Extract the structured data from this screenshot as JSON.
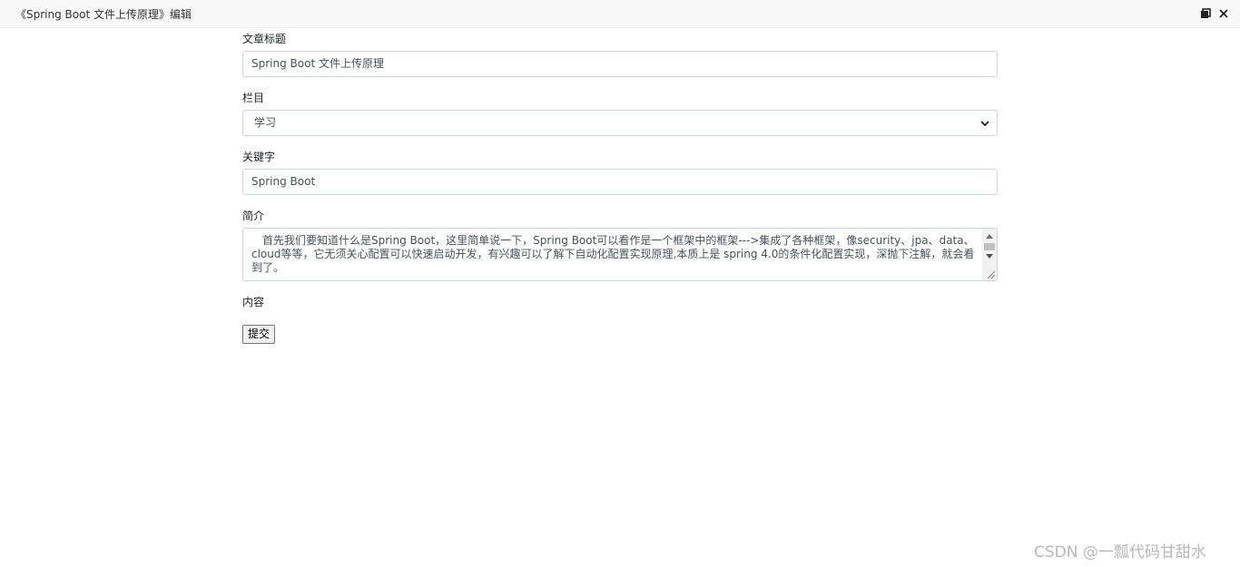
{
  "window": {
    "title": "《Spring Boot 文件上传原理》编辑",
    "maximize_icon": "restore-window-icon",
    "close_icon": "close-icon"
  },
  "form": {
    "title_label": "文章标题",
    "title_value": "Spring Boot 文件上传原理",
    "category_label": "栏目",
    "category_value": "学习",
    "keywords_label": "关键字",
    "keywords_value": "Spring Boot",
    "summary_label": "简介",
    "summary_value": "首先我们要知道什么是Spring Boot，这里简单说一下，Spring Boot可以看作是一个框架中的框架--->集成了各种框架，像security、jpa、data、cloud等等，它无须关心配置可以快速启动开发，有兴趣可以了解下自动化配置实现原理,本质上是 spring 4.0的条件化配置实现，深抛下注解，就会看到了。",
    "content_label": "内容",
    "submit_label": "提交"
  },
  "watermark": "CSDN @一瓢代码甘甜水"
}
